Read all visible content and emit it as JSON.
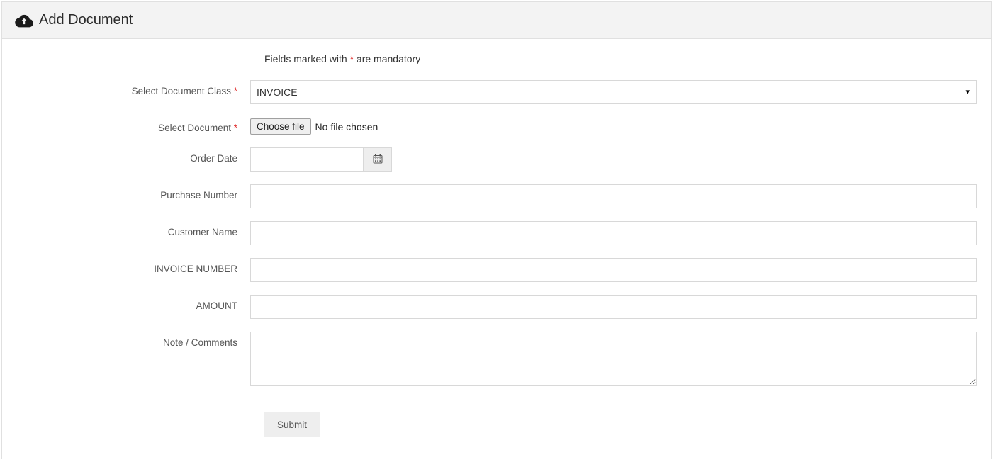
{
  "header": {
    "title": "Add Document"
  },
  "hint": {
    "prefix": "Fields marked with ",
    "mark": "*",
    "suffix": " are mandatory"
  },
  "form": {
    "doc_class": {
      "label": "Select Document Class",
      "required": "*",
      "value": "INVOICE"
    },
    "doc_file": {
      "label": "Select Document",
      "required": "*",
      "button": "Choose file",
      "status": "No file chosen"
    },
    "order_date": {
      "label": "Order Date",
      "value": ""
    },
    "purchase_number": {
      "label": "Purchase Number",
      "value": ""
    },
    "customer_name": {
      "label": "Customer Name",
      "value": ""
    },
    "invoice_number": {
      "label": "INVOICE NUMBER",
      "value": ""
    },
    "amount": {
      "label": "AMOUNT",
      "value": ""
    },
    "note": {
      "label": "Note / Comments",
      "value": ""
    }
  },
  "actions": {
    "submit": "Submit"
  }
}
